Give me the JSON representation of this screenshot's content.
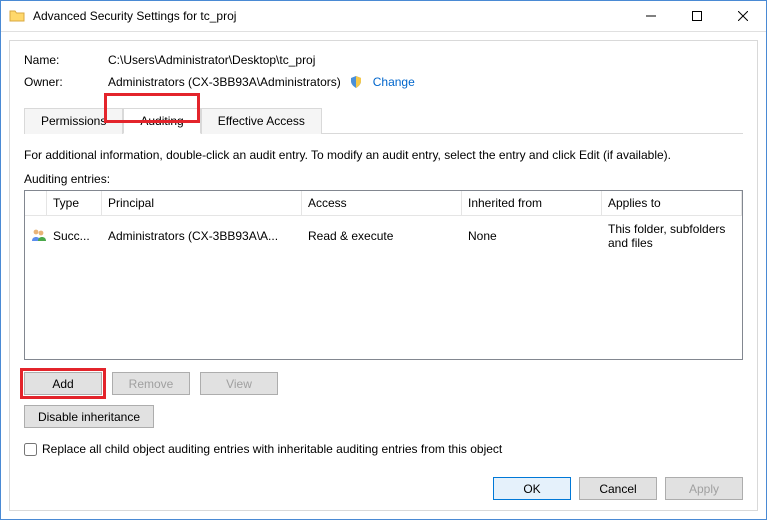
{
  "window": {
    "title": "Advanced Security Settings for tc_proj"
  },
  "info": {
    "name_label": "Name:",
    "name_value": "C:\\Users\\Administrator\\Desktop\\tc_proj",
    "owner_label": "Owner:",
    "owner_value": "Administrators (CX-3BB93A\\Administrators)",
    "change_link": "Change"
  },
  "tabs": {
    "permissions": "Permissions",
    "auditing": "Auditing",
    "effective": "Effective Access"
  },
  "body": {
    "instructions": "For additional information, double-click an audit entry. To modify an audit entry, select the entry and click Edit (if available).",
    "entries_label": "Auditing entries:"
  },
  "grid": {
    "headers": {
      "type": "Type",
      "principal": "Principal",
      "access": "Access",
      "inherited": "Inherited from",
      "applies": "Applies to"
    },
    "rows": [
      {
        "type": "Succ...",
        "principal": "Administrators (CX-3BB93A\\A...",
        "access": "Read & execute",
        "inherited": "None",
        "applies": "This folder, subfolders and files"
      }
    ]
  },
  "buttons": {
    "add": "Add",
    "remove": "Remove",
    "view": "View",
    "disable_inheritance": "Disable inheritance",
    "ok": "OK",
    "cancel": "Cancel",
    "apply": "Apply"
  },
  "checkbox": {
    "replace": "Replace all child object auditing entries with inheritable auditing entries from this object"
  }
}
